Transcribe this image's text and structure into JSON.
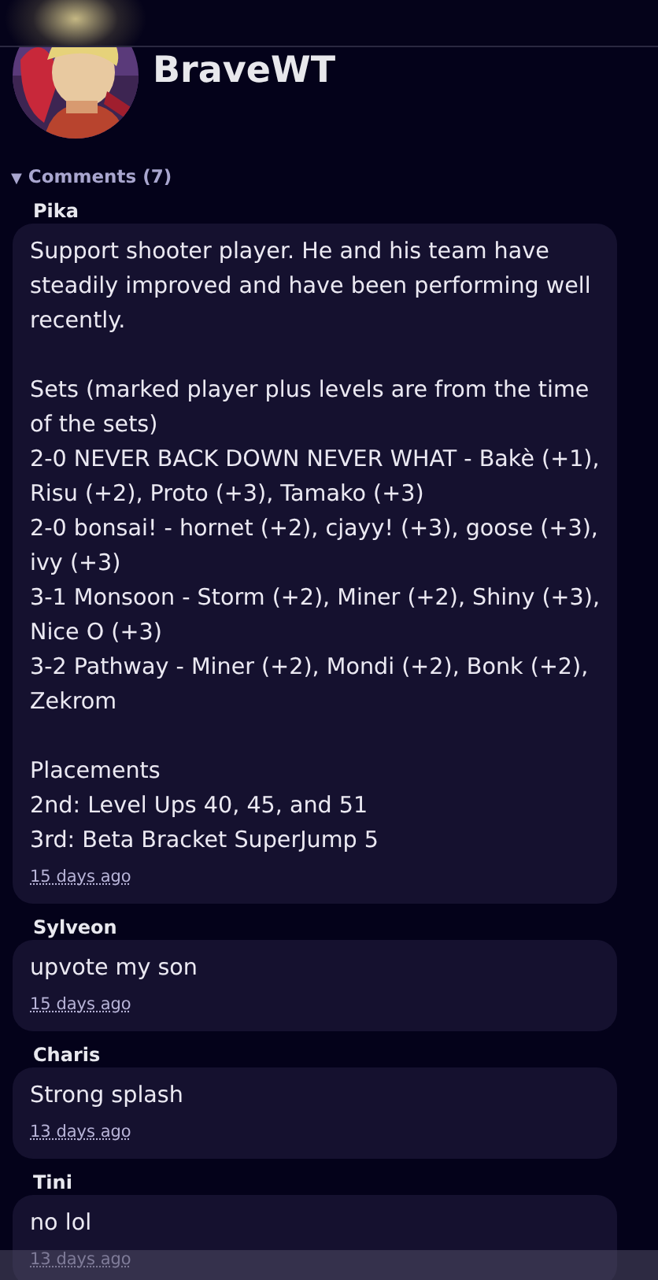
{
  "profile": {
    "name": "BraveWT"
  },
  "comments_section": {
    "toggle": "▼",
    "label": "Comments (7)",
    "expanded": true
  },
  "comments": [
    {
      "author": "Pika",
      "text": "Support shooter player. He and his team have steadily improved and have been performing well recently.\n\nSets (marked player plus levels are from the time of the sets)\n2-0 NEVER BACK DOWN NEVER WHAT - Bakè (+1), Risu (+2), Proto (+3), Tamako (+3)\n2-0 bonsai! - hornet (+2), cjayy! (+3), goose (+3), ivy (+3)\n3-1 Monsoon - Storm (+2), Miner (+2), Shiny (+3), Nice O (+3)\n3-2 Pathway - Miner (+2), Mondi (+2), Bonk (+2), Zekrom\n\nPlacements\n2nd: Level Ups 40, 45, and 51\n3rd: Beta Bracket SuperJump 5",
      "time": "15 days ago"
    },
    {
      "author": "Sylveon",
      "text": "upvote my son",
      "time": "15 days ago"
    },
    {
      "author": "Charis",
      "text": "Strong splash",
      "time": "13 days ago"
    },
    {
      "author": "Tini",
      "text": "no lol",
      "time": "13 days ago"
    }
  ]
}
